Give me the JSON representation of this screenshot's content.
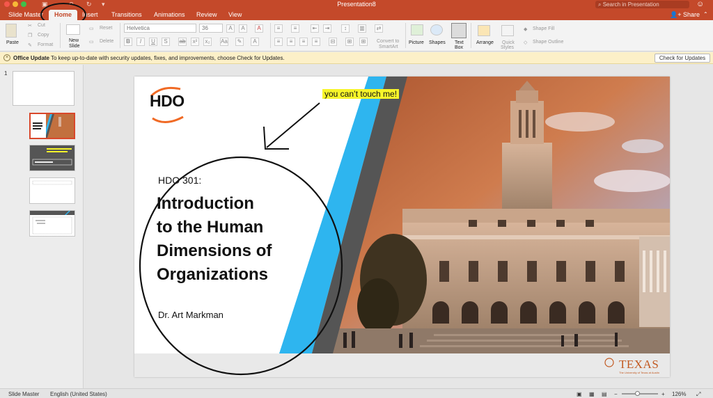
{
  "titlebar": {
    "document_title": "Presentation8",
    "search_placeholder": "Search in Presentation"
  },
  "tabs": [
    {
      "label": "Slide Master"
    },
    {
      "label": "Home"
    },
    {
      "label": "Insert"
    },
    {
      "label": "Transitions"
    },
    {
      "label": "Animations"
    },
    {
      "label": "Review"
    },
    {
      "label": "View"
    }
  ],
  "share_label": "Share",
  "ribbon": {
    "paste": "Paste",
    "cut": "Cut",
    "copy": "Copy",
    "format": "Format",
    "new_slide": "New",
    "new_slide_2": "Slide",
    "reset": "Reset",
    "delete": "Delete",
    "font_name": "Helvetica",
    "font_size": "36",
    "convert_smartart_1": "Convert to",
    "convert_smartart_2": "SmartArt",
    "picture": "Picture",
    "shapes": "Shapes",
    "text_box_1": "Text",
    "text_box_2": "Box",
    "arrange": "Arrange",
    "quick_styles_1": "Quick",
    "quick_styles_2": "Styles",
    "shape_fill": "Shape Fill",
    "shape_outline": "Shape Outline"
  },
  "notification": {
    "title": "Office Update",
    "message": "To keep up-to-date with security updates, fixes, and improvements, choose Check for Updates.",
    "button": "Check for Updates"
  },
  "thumbnails": {
    "slide_number": "1"
  },
  "slide": {
    "logo_text": "HDO",
    "callout": "you can’t touch me!",
    "course_code": "HDO 301:",
    "title_lines": [
      "Introduction",
      "to the Human",
      "Dimensions of",
      "Organizations"
    ],
    "author": "Dr. Art Markman",
    "texas_word": "TEXAS",
    "texas_sub": "The University of Texas at Austin"
  },
  "statusbar": {
    "view": "Slide Master",
    "language": "English (United States)",
    "zoom": "126%"
  },
  "colors": {
    "brand": "#c4492a",
    "accent_blue": "#2eb5ef",
    "accent_gray": "#555555",
    "texas_orange": "#c25a22",
    "callout_yellow": "#f7f52a"
  }
}
